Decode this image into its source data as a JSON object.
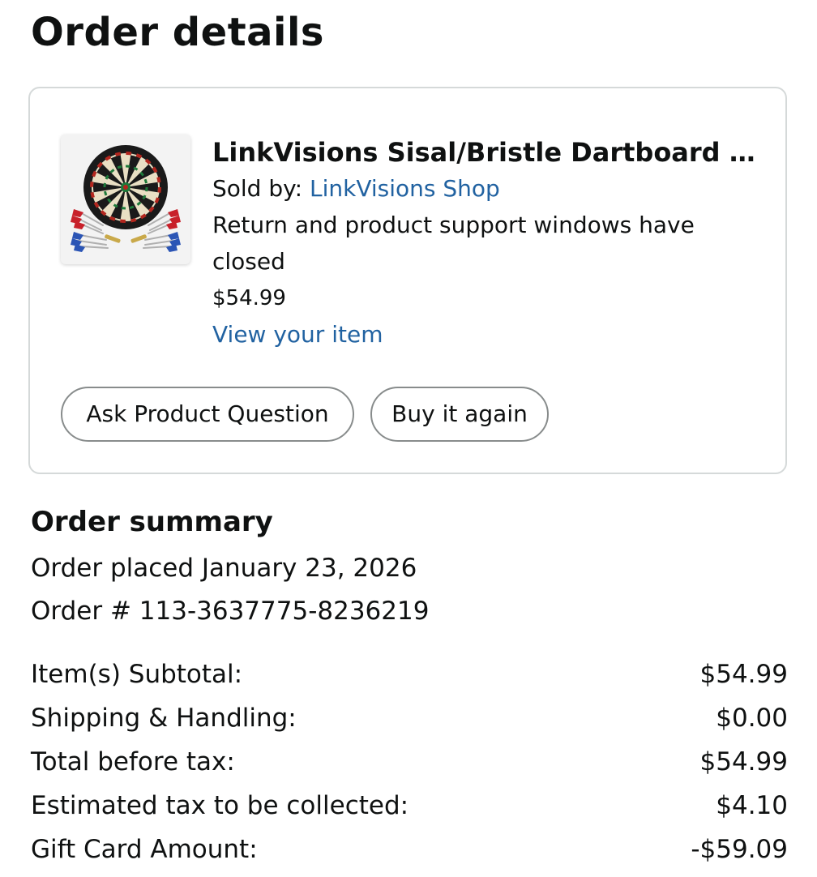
{
  "page": {
    "title": "Order details"
  },
  "item": {
    "image_icon": "dartboard-product-image",
    "title": "LinkVisions Sisal/Bristle Dartboard w...",
    "sold_by_label": "Sold by: ",
    "seller": "LinkVisions Shop",
    "return_note": "Return and product support windows have closed",
    "price": "$54.99",
    "view_item_link": "View your item",
    "buttons": {
      "ask_question": "Ask Product Question",
      "buy_again": "Buy it again"
    }
  },
  "summary": {
    "title": "Order summary",
    "order_placed": "Order placed January 23, 2026",
    "order_number": "Order # 113-3637775-8236219",
    "rows": [
      {
        "label": "Item(s) Subtotal:",
        "value": "$54.99"
      },
      {
        "label": "Shipping & Handling:",
        "value": "$0.00"
      },
      {
        "label": "Total before tax:",
        "value": "$54.99"
      },
      {
        "label": "Estimated tax to be collected:",
        "value": "$4.10"
      },
      {
        "label": "Gift Card Amount:",
        "value": "-$59.09"
      }
    ]
  },
  "colors": {
    "link": "#2162a1",
    "text": "#0f1111",
    "border": "#d5d9d9",
    "button_border": "#888c8c"
  }
}
